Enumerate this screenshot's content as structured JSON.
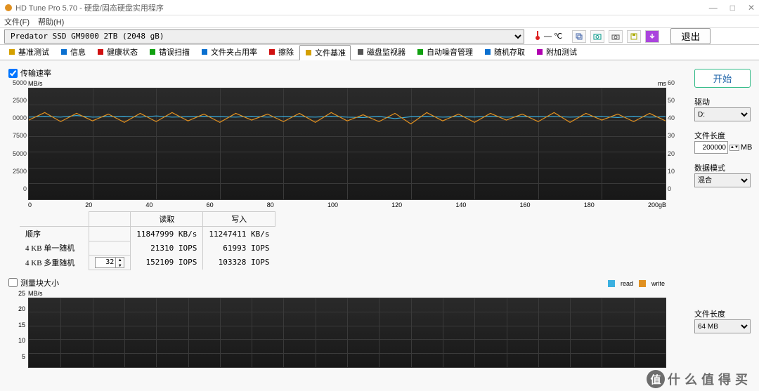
{
  "window": {
    "title": "HD Tune Pro 5.70 - 硬盘/固态硬盘实用程序",
    "min": "—",
    "max": "□",
    "close": "✕"
  },
  "menus": {
    "file": "文件(F)",
    "help": "帮助(H)"
  },
  "device": "Predator SSD GM9000 2TB (2048 gB)",
  "temperature": "— ℃",
  "exit": "退出",
  "tabs": [
    {
      "label": "基准测试",
      "color": "#d4a000"
    },
    {
      "label": "信息",
      "color": "#0b70d0"
    },
    {
      "label": "健康状态",
      "color": "#d01010"
    },
    {
      "label": "错误扫描",
      "color": "#10a010"
    },
    {
      "label": "文件夹占用率",
      "color": "#0b70d0"
    },
    {
      "label": "擦除",
      "color": "#d01010"
    },
    {
      "label": "文件基准",
      "color": "#d4a000"
    },
    {
      "label": "磁盘监视器",
      "color": "#555"
    },
    {
      "label": "自动噪音管理",
      "color": "#10a010"
    },
    {
      "label": "随机存取",
      "color": "#0b70d0"
    },
    {
      "label": "附加测试",
      "color": "#b000b0"
    }
  ],
  "active_tab_index": 6,
  "chk_transfer": "传输速率",
  "chk_block": "测量块大小",
  "chart1": {
    "ylabel_left": "MB/s",
    "ylabel_right": "ms",
    "yticks_left": [
      "5000",
      "2500",
      "0000",
      "7500",
      "5000",
      "2500",
      "0"
    ],
    "yticks_right": [
      "60",
      "50",
      "40",
      "30",
      "20",
      "10",
      "0"
    ],
    "xticks": [
      "0",
      "20",
      "40",
      "60",
      "80",
      "100",
      "120",
      "140",
      "160",
      "180",
      "200"
    ]
  },
  "chart2": {
    "ylabel_left": "MB/s",
    "yticks_left": [
      "25",
      "20",
      "15",
      "10",
      "5"
    ]
  },
  "legend": {
    "read": "read",
    "write": "write",
    "read_color": "#3bb0e0",
    "write_color": "#e09020"
  },
  "results": {
    "col_read": "读取",
    "col_write": "写入",
    "rows": [
      {
        "label": "顺序",
        "read": "11847999 KB/s",
        "write": "11247411 KB/s"
      },
      {
        "label": "4 KB 单一随机",
        "read": "21310 IOPS",
        "write": "61993 IOPS"
      },
      {
        "label": "4 KB 多重随机",
        "read": "152109 IOPS",
        "write": "103328 IOPS"
      }
    ],
    "threads": "32"
  },
  "right": {
    "start": "开始",
    "drive_lbl": "驱动",
    "drive_val": "D:",
    "filelen_lbl": "文件长度",
    "filelen_val": "200000",
    "filelen_unit": "MB",
    "pattern_lbl": "数据模式",
    "pattern_val": "混合",
    "filelen2_lbl": "文件长度",
    "filelen2_val": "64 MB"
  },
  "watermark": "什么值得买",
  "chart_data": {
    "type": "line",
    "title": "传输速率",
    "xlabel": "gB",
    "ylabel": "MB/s",
    "xlim": [
      0,
      200
    ],
    "ylim_left": [
      0,
      15000
    ],
    "ylim_right": [
      0,
      60
    ],
    "x": [
      0,
      5,
      10,
      15,
      20,
      25,
      30,
      35,
      40,
      45,
      50,
      55,
      60,
      65,
      70,
      75,
      80,
      85,
      90,
      95,
      100,
      105,
      110,
      115,
      120,
      125,
      130,
      135,
      140,
      145,
      150,
      155,
      160,
      165,
      170,
      175,
      180,
      185,
      190,
      195,
      200
    ],
    "series": [
      {
        "name": "read",
        "axis": "left",
        "color": "#3bb0e0",
        "values": [
          11200,
          11300,
          11200,
          11400,
          11200,
          11250,
          11300,
          11200,
          11350,
          11200,
          11250,
          11300,
          11250,
          11200,
          11300,
          11200,
          11280,
          11250,
          11200,
          11300,
          11200,
          11150,
          11300,
          11000,
          11250,
          11300,
          11200,
          11260,
          11220,
          11300,
          11200,
          11260,
          11240,
          11280,
          11200,
          11260,
          11280,
          11150,
          11300,
          11200,
          11250
        ]
      },
      {
        "name": "write",
        "axis": "left",
        "color": "#e09020",
        "values": [
          10800,
          11800,
          10600,
          11700,
          10700,
          11600,
          10500,
          11700,
          10600,
          11800,
          10700,
          11600,
          10500,
          11700,
          10800,
          11600,
          10600,
          11700,
          10500,
          11800,
          10700,
          11500,
          10600,
          11700,
          10300,
          11800,
          10700,
          11600,
          10500,
          11700,
          10800,
          11600,
          10600,
          11800,
          10500,
          11700,
          10800,
          11600,
          10600,
          11700,
          10700
        ]
      }
    ]
  }
}
